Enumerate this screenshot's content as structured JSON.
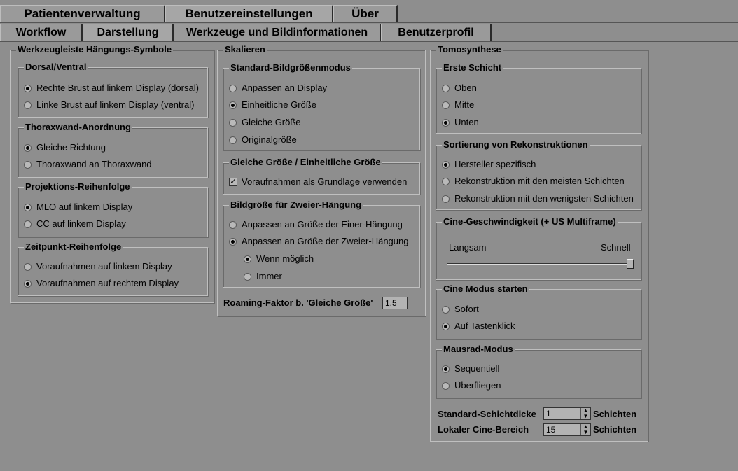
{
  "tabs_top": [
    "Patientenverwaltung",
    "Benutzereinstellungen",
    "Über"
  ],
  "tabs_sub": [
    "Workflow",
    "Darstellung",
    "Werkzeuge und Bildinformationen",
    "Benutzerprofil"
  ],
  "left": {
    "title": "Werkzeugleiste Hängungs-Symbole",
    "dorsal": {
      "title": "Dorsal/Ventral",
      "opt1": "Rechte Brust auf linkem Display (dorsal)",
      "opt2": "Linke Brust auf linkem Display (ventral)"
    },
    "thorax": {
      "title": "Thoraxwand-Anordnung",
      "opt1": "Gleiche Richtung",
      "opt2": "Thoraxwand an Thoraxwand"
    },
    "proj": {
      "title": "Projektions-Reihenfolge",
      "opt1": "MLO auf linkem Display",
      "opt2": "CC auf linkem Display"
    },
    "zeit": {
      "title": "Zeitpunkt-Reihenfolge",
      "opt1": "Voraufnahmen auf linkem Display",
      "opt2": "Voraufnahmen auf rechtem Display"
    }
  },
  "middle": {
    "title": "Skalieren",
    "std": {
      "title": "Standard-Bildgrößenmodus",
      "opt1": "Anpassen an Display",
      "opt2": "Einheitliche Größe",
      "opt3": "Gleiche Größe",
      "opt4": "Originalgröße"
    },
    "gleich": {
      "title": "Gleiche Größe / Einheitliche Größe",
      "check": "Voraufnahmen als Grundlage verwenden"
    },
    "zweier": {
      "title": "Bildgröße für Zweier-Hängung",
      "opt1": "Anpassen an Größe der Einer-Hängung",
      "opt2": "Anpassen an Größe der Zweier-Hängung",
      "sub1": "Wenn möglich",
      "sub2": "Immer"
    },
    "roaming_label": "Roaming-Faktor b. 'Gleiche Größe'",
    "roaming_value": "1.5"
  },
  "right": {
    "title": "Tomosynthese",
    "erste": {
      "title": "Erste Schicht",
      "opt1": "Oben",
      "opt2": "Mitte",
      "opt3": "Unten"
    },
    "sort": {
      "title": "Sortierung von Rekonstruktionen",
      "opt1": "Hersteller spezifisch",
      "opt2": "Rekonstruktion mit den meisten Schichten",
      "opt3": "Rekonstruktion mit den wenigsten Schichten"
    },
    "cine": {
      "title": "Cine-Geschwindigkeit (+ US Multiframe)",
      "slow": "Langsam",
      "fast": "Schnell",
      "level": 1.0
    },
    "modus": {
      "title": "Cine Modus starten",
      "opt1": "Sofort",
      "opt2": "Auf Tastenklick"
    },
    "maus": {
      "title": "Mausrad-Modus",
      "opt1": "Sequentiell",
      "opt2": "Überfliegen"
    },
    "dicke_label": "Standard-Schichtdicke",
    "dicke_value": "1",
    "dicke_unit": "Schichten",
    "bereich_label": "Lokaler Cine-Bereich",
    "bereich_value": "15",
    "bereich_unit": "Schichten"
  }
}
